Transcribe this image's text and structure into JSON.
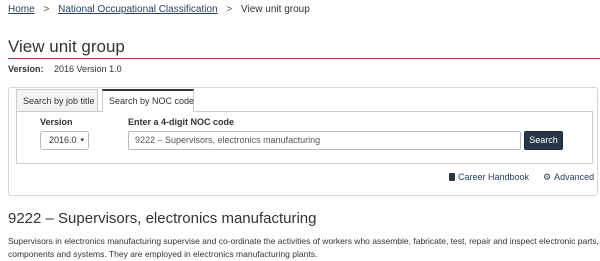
{
  "breadcrumb": {
    "items": [
      "Home",
      "National Occupational Classification"
    ],
    "separator": ">",
    "current": "View unit group"
  },
  "page": {
    "title": "View unit group",
    "version_label": "Version:",
    "version_value": "2016 Version 1.0"
  },
  "tabs": [
    {
      "label": "Search by job title",
      "active": false
    },
    {
      "label": "Search by NOC code",
      "active": true
    }
  ],
  "form": {
    "version_label": "Version",
    "version_selected": "2016.0",
    "code_label": "Enter a 4-digit NOC code",
    "code_value": "9222 – Supervisors, electronics manufacturing",
    "search_button": "Search"
  },
  "links": {
    "career_handbook": "Career Handbook",
    "advanced": "Advanced"
  },
  "result": {
    "heading": "9222 – Supervisors, electronics manufacturing",
    "description": "Supervisors in electronics manufacturing supervise and co-ordinate the activities of workers who assemble, fabricate, test, repair and inspect electronic parts, components and systems. They are employed in electronics manufacturing plants."
  },
  "colors": {
    "link": "#284162",
    "button": "#26374a",
    "title_rule": "#af3c43"
  },
  "icons": [
    "book-icon",
    "gear-icon",
    "caret-down-icon"
  ]
}
